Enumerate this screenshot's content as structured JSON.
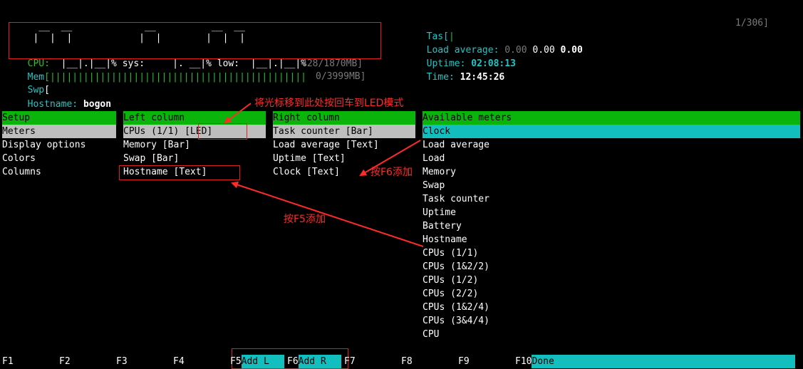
{
  "header": {
    "led_line1": "    __  __             __          __  __ ",
    "led_line2": "   |  |  |            |  |        |  |  | ",
    "led_line3_label": "CPU:",
    "led_line3": "  |__|.|__|% sys:     |. __|% low:  |__|.|__|%",
    "mem_label": "Mem",
    "mem_bar": "[||||||||||||||||||||||||||||||||||||||||||||||",
    "mem_value": "428/1870MB]",
    "swp_label": "Swp",
    "swp_bar": "[",
    "swp_value": "0/3999MB]",
    "hostname_label": "Hostname:",
    "hostname_value": "bogon",
    "tasks_label": "Tas[",
    "tasks_bar": "|",
    "tasks_value": "1/306]",
    "load_label": "Load average:",
    "load_1": "0.00",
    "load_5": "0.00",
    "load_15": "0.00",
    "uptime_label": "Uptime:",
    "uptime_value": "02:08:13",
    "time_label": "Time:",
    "time_value": "12:45:26"
  },
  "setup": {
    "header": "Setup",
    "items": [
      "Meters",
      "Display options",
      "Colors",
      "Columns"
    ]
  },
  "left_column": {
    "header": "Left column",
    "items": [
      "CPUs (1/1) [LED]",
      "Memory [Bar]",
      "Swap [Bar]",
      "Hostname [Text]"
    ]
  },
  "right_column": {
    "header": "Right column",
    "items": [
      "Task counter [Bar]",
      "Load average [Text]",
      "Uptime [Text]",
      "Clock [Text]"
    ]
  },
  "available_meters": {
    "header": "Available meters",
    "items": [
      "Clock",
      "Load average",
      "Load",
      "Memory",
      "Swap",
      "Task counter",
      "Uptime",
      "Battery",
      "Hostname",
      "CPUs (1/1)",
      "CPUs (1&2/2)",
      "CPUs (1/2)",
      "CPUs (2/2)",
      "CPUs (1&2/4)",
      "CPUs (3&4/4)",
      "CPU"
    ]
  },
  "annotations": {
    "led_hint": "将光标移到此处按回车到LED模式",
    "f6_hint": "按F6添加",
    "f5_hint": "按F5添加"
  },
  "function_bar": [
    {
      "key": "F1",
      "label": ""
    },
    {
      "key": "F2",
      "label": ""
    },
    {
      "key": "F3",
      "label": ""
    },
    {
      "key": "F4",
      "label": ""
    },
    {
      "key": "F5",
      "label": "Add L "
    },
    {
      "key": "F6",
      "label": "Add R "
    },
    {
      "key": "F7",
      "label": ""
    },
    {
      "key": "F8",
      "label": ""
    },
    {
      "key": "F9",
      "label": ""
    },
    {
      "key": "F10",
      "label": "Done  "
    }
  ],
  "colors": {
    "header_green": "#0ab40a",
    "selection_gray": "#bebebe",
    "selection_cyan": "#12bebe",
    "annotation_red": "#ff2a2a"
  }
}
